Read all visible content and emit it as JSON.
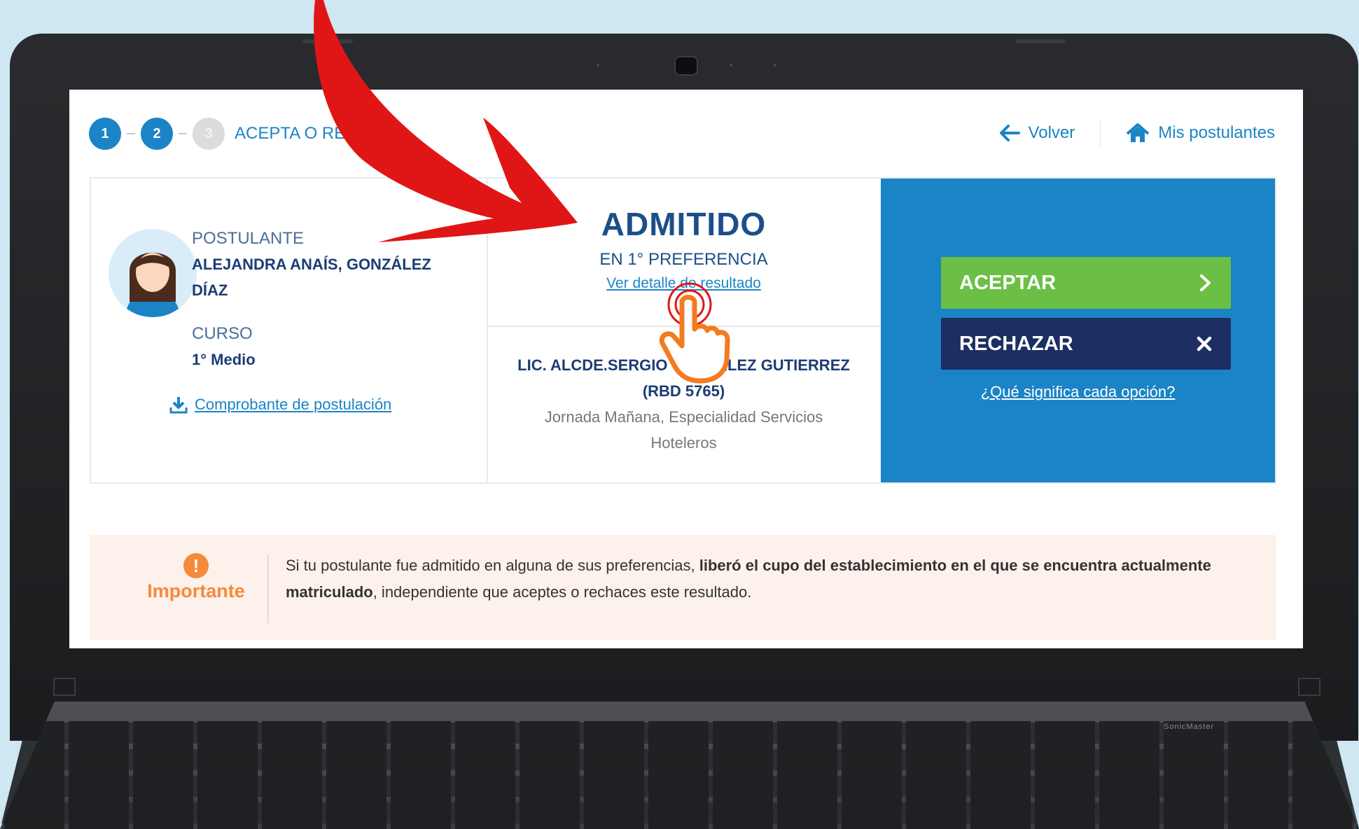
{
  "steps": {
    "items": [
      {
        "number": "1",
        "state": "done"
      },
      {
        "number": "2",
        "state": "done"
      },
      {
        "number": "3",
        "state": "current"
      }
    ],
    "current_label": "ACEPTA O RECHAZA"
  },
  "nav": {
    "back_label": "Volver",
    "home_label": "Mis postulantes"
  },
  "applicant": {
    "label": "POSTULANTE",
    "name_line1": "ALEJANDRA ANAÍS, GONZÁLEZ",
    "name_line2": "DÍAZ",
    "course_label": "CURSO",
    "course_value": "1° Medio",
    "receipt_link": "Comprobante de postulación"
  },
  "result": {
    "status": "ADMITIDO",
    "preference": "EN 1° PREFERENCIA",
    "detail_link": "Ver detalle de resultado",
    "school_line1": "LIC. ALCDE.SERGIO GONZALEZ GUTIERREZ",
    "school_line2": "(RBD 5765)",
    "school_info_line1": "Jornada Mañana, Especialidad Servicios",
    "school_info_line2": "Hoteleros"
  },
  "actions": {
    "accept_label": "ACEPTAR",
    "reject_label": "RECHAZAR",
    "options_link": "¿Qué significa cada opción?"
  },
  "notice": {
    "title": "Importante",
    "text_part1": "Si tu postulante fue admitido en alguna de sus preferencias, ",
    "text_bold": "liberó el cupo del establecimiento en el que se encuentra actualmente matriculado",
    "text_part2": ", independiente que aceptes o rechaces este resultado."
  },
  "colors": {
    "primary": "#1b84c6",
    "navy": "#1c2e63",
    "accept": "#6bbf45",
    "warning": "#f58a3b",
    "arrow": "#e01616",
    "hand": "#f47b20"
  },
  "icons": {
    "back": "arrow-left-icon",
    "home": "home-icon",
    "download": "download-icon",
    "accept": "chevron-right-icon",
    "reject": "close-icon",
    "notice": "exclamation-icon"
  }
}
